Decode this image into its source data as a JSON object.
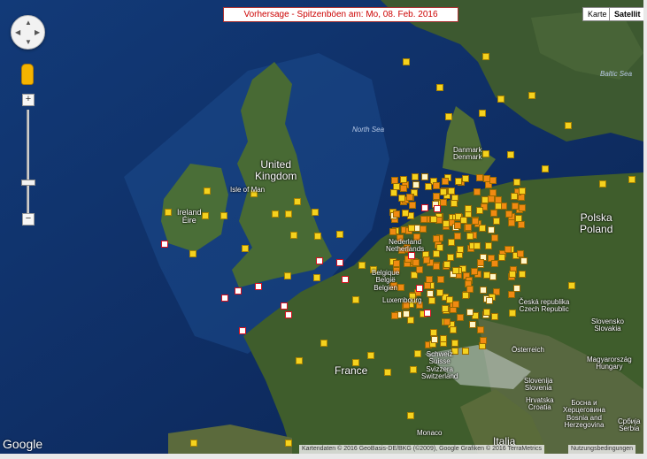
{
  "header": {
    "title": "Vorhersage - Spitzenböen am: Mo, 08. Feb. 2016"
  },
  "map_type": {
    "map_label": "Karte",
    "satellite_label": "Satellit"
  },
  "zoom": {
    "in_label": "+",
    "out_label": "−"
  },
  "place_labels": {
    "united_kingdom": "United\nKingdom",
    "isle_of_man": "Isle of Man",
    "ireland": "Ireland\nÉire",
    "north_sea": "North Sea",
    "baltic_sea": "Baltic Sea",
    "denmark": "Danmark\nDenmark",
    "nederland": "Nederland\nNetherlands",
    "belgium": "Belgique\nBelgië\nBelgien",
    "luxembourg": "Luxembourg",
    "france": "France",
    "schweiz": "Schweiz\nSuisse\nSvizzera\nSwitzerland",
    "polska": "Polska\nPoland",
    "czech": "Česká republika\nCzech Republic",
    "osterreich": "Österreich",
    "slovensko": "Slovensko\nSlovakia",
    "magyarorszag": "Magyarország\nHungary",
    "slovenia": "Slovenija\nSlovenia",
    "hrvatska": "Hrvatska\nCroatia",
    "bosna": "Босна и\nХерцеговина\nBosnia and\nHerzegovina",
    "srbija": "Србија\nSerbia",
    "monaco": "Monaco",
    "italia": "Italia"
  },
  "footer": {
    "logo": "Google",
    "attribution": "Kartendaten © 2016 GeoBasis-DE/BKG (©2009), Google Grafiken © 2016 TerraMetrics",
    "terms": "Nutzungsbedingungen"
  },
  "colors": {
    "marker_yellow": "#f5d21e",
    "marker_orange": "#f08a12",
    "marker_red": "#d8101e",
    "marker_gold": "#f4b400",
    "sea": "#0d2a5c",
    "land": "#3f5d2c"
  }
}
